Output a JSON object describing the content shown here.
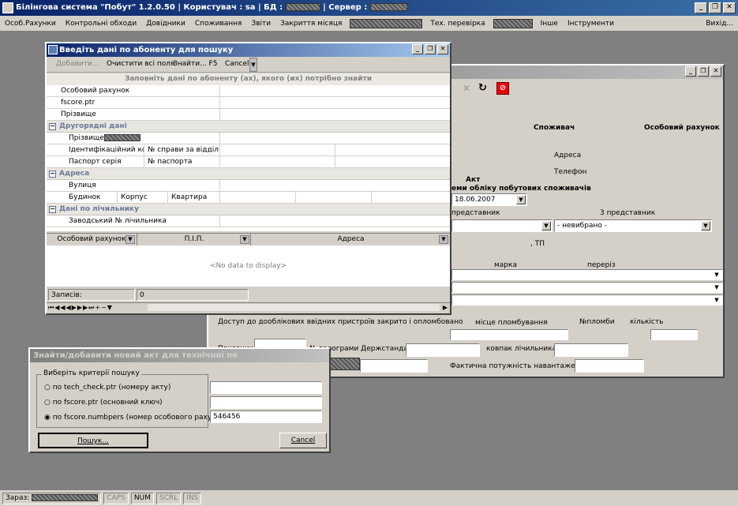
{
  "app": {
    "title_prefix": "Білінгова система \"Побут\" 1.2.0.50  |  Користувач : sa  |  БД :",
    "title_server": "|  Сервер :"
  },
  "menu": {
    "items": [
      "Особ.Рахунки",
      "Контрольні обходи",
      "Довідники",
      "Споживання",
      "Звіти",
      "Закриття місяця"
    ],
    "tech_check": "Тех. перевірка",
    "other": "Інше",
    "tools": "Інструменти",
    "exit": "Вихід..."
  },
  "search_dialog": {
    "title": "Введіть дані по абоненту для пошуку",
    "toolbar": {
      "add": "Добавити...",
      "clear": "Очистити всі поля",
      "find": "Знайти... F5",
      "cancel": "Cancel"
    },
    "hint": "Заповніть дані по абоненту (ах), якого (их) потрібно знайти",
    "fields": {
      "account": "Особовий рахунок",
      "fscore": "fscore.ptr",
      "surname": "Прізвище"
    },
    "secondary": {
      "header": "Другорядні дані",
      "surname": "Прізвище",
      "id_code": "Ідентифікаційний код",
      "case_no": "№ справи за відділ...",
      "passport_series": "Паспорт серія",
      "passport_no": "№ паспорта"
    },
    "address": {
      "header": "Адреса",
      "street": "Вулиця",
      "house": "Будинок",
      "building": "Корпус",
      "apartment": "Квартира"
    },
    "meter": {
      "header": "Дані по лічильнику",
      "serial": "Заводський № лічильника"
    },
    "results": {
      "columns": [
        "Особовий рахунок",
        "П.І.П.",
        "Адреса"
      ],
      "empty": "<No data to display>",
      "records_label": "Записів:",
      "records_count": "0"
    }
  },
  "act_window": {
    "consumer": "Споживач",
    "account": "Особовий рахунок",
    "address": "Адреса",
    "phone": "Телефон",
    "act_title": "Акт",
    "act_subtitle": "еми обліку побутових споживачів",
    "date": "18.06.2007",
    "rep_left": "представник",
    "rep3": "3 представник",
    "not_selected": "- невибрано -",
    "tp": ", ТП",
    "brand": "марка",
    "section": "переріз",
    "access_closed": "Доступ до дооблікових ввідних пристроїв закрито і опломбовано",
    "seal_place": "місце пломбування",
    "seal_no": "№пломби",
    "quantity": "кількість",
    "reading": "Показник",
    "hologram": "№ голограми Держстандарту",
    "cover": "ковпак лічильника",
    "load": "Фактична потужність навантаження"
  },
  "find_dialog": {
    "title": "Знайти/добавити новий акт для технічної пе",
    "criteria": "Виберіть критерії пошуку",
    "opt1": "по tech_check.ptr (номеру акту)",
    "opt2": "по fscore.ptr (основний ключ)",
    "opt3": "по fscore.numbpers (номер особового рахунку)",
    "value": "546456",
    "search": "Пошук...",
    "cancel": "Cancel"
  },
  "status": {
    "now": "Зараз:",
    "caps": "CAPS",
    "num": "NUM",
    "scrl": "SCRL",
    "ins": "INS"
  }
}
